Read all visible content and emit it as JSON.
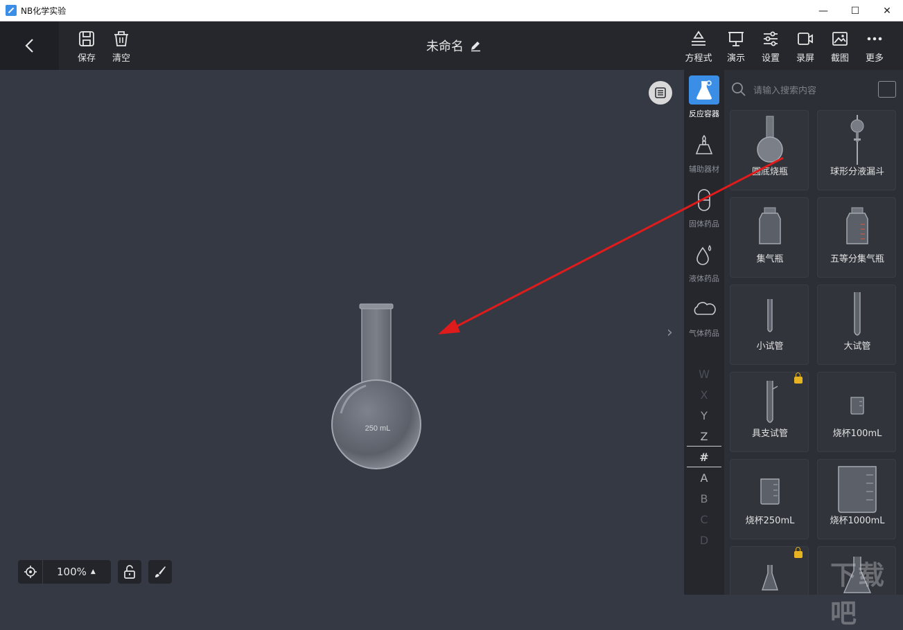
{
  "window": {
    "title": "NB化学实验",
    "controls": [
      "—",
      "☐",
      "✕"
    ]
  },
  "toolbar": {
    "save_label": "保存",
    "clear_label": "清空",
    "doc_title": "未命名",
    "right_tools": [
      "方程式",
      "演示",
      "设置",
      "录屏",
      "截图",
      "更多"
    ]
  },
  "categories": [
    {
      "label": "反应容器",
      "icon": "flask-icon",
      "active": true
    },
    {
      "label": "辅助器材",
      "icon": "burner-icon",
      "active": false
    },
    {
      "label": "固体药品",
      "icon": "capsule-icon",
      "active": false
    },
    {
      "label": "液体药品",
      "icon": "droplet-icon",
      "active": false
    },
    {
      "label": "气体药品",
      "icon": "cloud-icon",
      "active": false
    }
  ],
  "alphabet": [
    "W",
    "X",
    "Y",
    "Z",
    "#",
    "A",
    "B",
    "C",
    "D"
  ],
  "search": {
    "placeholder": "请输入搜索内容"
  },
  "items": [
    {
      "label": "圆底烧瓶",
      "icon": "round-bottom-flask-icon",
      "locked": false
    },
    {
      "label": "球形分液漏斗",
      "icon": "separatory-funnel-icon",
      "locked": false
    },
    {
      "label": "集气瓶",
      "icon": "gas-jar-icon",
      "locked": false
    },
    {
      "label": "五等分集气瓶",
      "icon": "graduated-gas-jar-icon",
      "locked": false
    },
    {
      "label": "小试管",
      "icon": "small-test-tube-icon",
      "locked": false
    },
    {
      "label": "大试管",
      "icon": "large-test-tube-icon",
      "locked": false
    },
    {
      "label": "具支试管",
      "icon": "side-arm-tube-icon",
      "locked": true
    },
    {
      "label": "烧杯100mL",
      "icon": "beaker-icon",
      "locked": false
    },
    {
      "label": "烧杯250mL",
      "icon": "beaker-icon",
      "locked": false
    },
    {
      "label": "烧杯1000mL",
      "icon": "beaker-icon",
      "locked": false
    },
    {
      "label": "",
      "icon": "conical-flask-icon",
      "locked": true
    },
    {
      "label": "",
      "icon": "conical-flask-icon",
      "locked": false
    }
  ],
  "canvas": {
    "flask_label": "250 mL",
    "zoom": "100%"
  },
  "watermark": "下载吧",
  "colors": {
    "accent": "#3a8ee6",
    "arrow": "#e01b1b",
    "lock": "#e6b422"
  }
}
